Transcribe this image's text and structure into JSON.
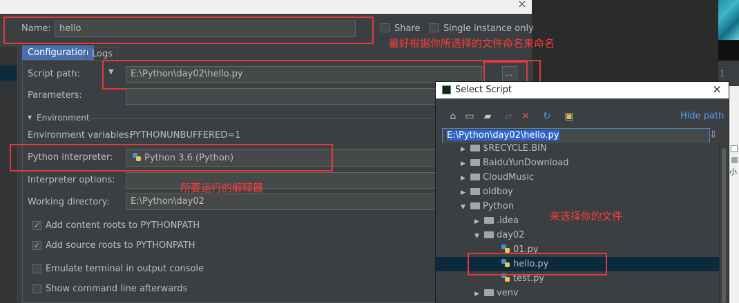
{
  "dialog": {
    "name_label": "Name:",
    "name_value": "hello",
    "share_label": "Share",
    "single_instance_label": "Single instance only",
    "tabs": [
      {
        "label": "Configuration",
        "active": true
      },
      {
        "label": "Logs",
        "active": false
      }
    ],
    "script_path_label": "Script path:",
    "script_path_value": "E:\\Python\\day02\\hello.py",
    "browse_label": "...",
    "parameters_label": "Parameters:",
    "environment_label": "Environment",
    "env_vars_label": "Environment variables:",
    "env_vars_value": "PYTHONUNBUFFERED=1",
    "interpreter_label": "Python interpreter:",
    "interpreter_value": "Python 3.6 (Python)",
    "interpreter_options_label": "Interpreter options:",
    "working_dir_label": "Working directory:",
    "working_dir_value": "E:\\Python\\day02",
    "checkboxes": [
      {
        "label": "Add content roots to PYTHONPATH",
        "checked": true
      },
      {
        "label": "Add source roots to PYTHONPATH",
        "checked": true
      },
      {
        "label": "Emulate terminal in output console",
        "checked": false
      },
      {
        "label": "Show command line afterwards",
        "checked": false
      }
    ]
  },
  "annotations": {
    "name_note": "最好根据你所选择的文件命名来命名",
    "interpreter_note": "所要运行的解释器",
    "file_note": "来选择你的文件"
  },
  "select_script": {
    "title": "Select Script",
    "hide_path": "Hide path",
    "path_value": "E:\\Python\\day02\\hello.py",
    "toolbar_icons": [
      "home-icon",
      "desktop-icon",
      "project-folder-icon",
      "new-folder-icon",
      "delete-icon",
      "refresh-icon",
      "show-hidden-icon"
    ],
    "tree": [
      {
        "label": "$RECYCLE.BIN",
        "level": 0,
        "type": "folder",
        "expanded": false
      },
      {
        "label": "BaiduYunDownload",
        "level": 0,
        "type": "folder",
        "expanded": false
      },
      {
        "label": "CloudMusic",
        "level": 0,
        "type": "folder",
        "expanded": false
      },
      {
        "label": "oldboy",
        "level": 0,
        "type": "folder",
        "expanded": false
      },
      {
        "label": "Python",
        "level": 0,
        "type": "folder",
        "expanded": true
      },
      {
        "label": ".idea",
        "level": 1,
        "type": "folder",
        "expanded": false
      },
      {
        "label": "day02",
        "level": 1,
        "type": "folder",
        "expanded": true
      },
      {
        "label": "01.py",
        "level": 2,
        "type": "file"
      },
      {
        "label": "hello.py",
        "level": 2,
        "type": "file",
        "selected": true
      },
      {
        "label": "test.py",
        "level": 2,
        "type": "file"
      },
      {
        "label": "venv",
        "level": 1,
        "type": "folder",
        "expanded": false
      }
    ]
  },
  "background": {
    "right_panel_fragment": "1",
    "far_right_fragment": "小"
  },
  "colors": {
    "accent": "#4b6eaf",
    "selection": "#0d293e",
    "annotation_red": "#e2393f",
    "link_blue": "#589df6"
  }
}
